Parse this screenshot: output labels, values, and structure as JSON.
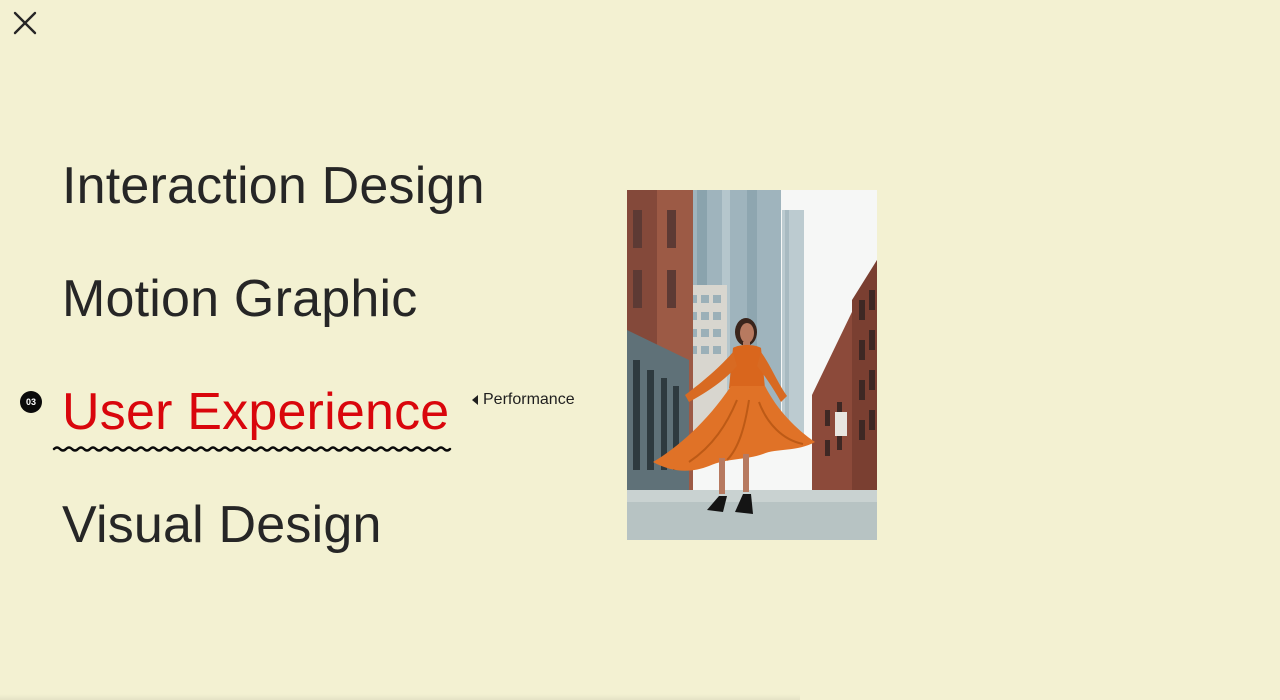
{
  "close": {
    "icon": "close-icon"
  },
  "menu": {
    "items": [
      {
        "label": "Interaction Design",
        "active": false
      },
      {
        "label": "Motion Graphic",
        "active": false
      },
      {
        "label": "User Experience",
        "active": true
      },
      {
        "label": "Visual Design",
        "active": false
      }
    ],
    "active_index": "03",
    "active_color": "#d9060c",
    "submenu": {
      "label": "Performance",
      "icon": "caret-left-icon"
    }
  },
  "preview": {
    "icon": "photo-woman-orange-dress-city-street"
  },
  "colors": {
    "background": "#f3f1d2",
    "text": "#262626",
    "accent": "#d9060c"
  }
}
